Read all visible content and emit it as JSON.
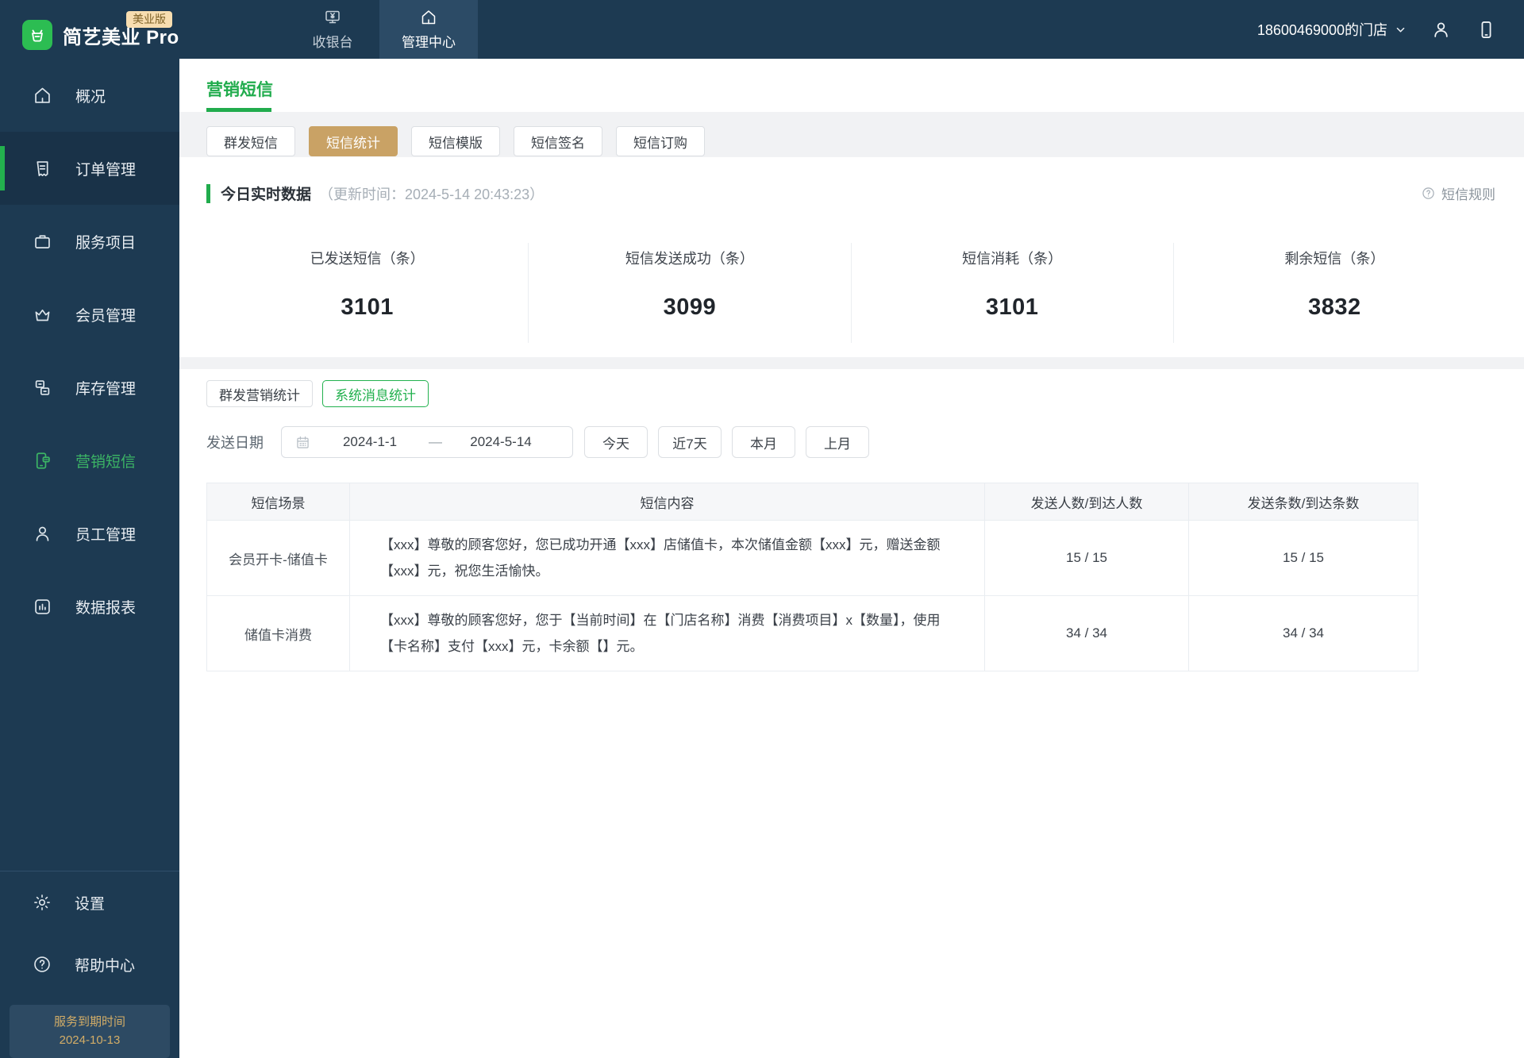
{
  "topbar": {
    "badge": "美业版",
    "brand": "简艺美业 Pro",
    "tabs": [
      {
        "label": "收银台",
        "icon": "cash-register-icon"
      },
      {
        "label": "管理中心",
        "icon": "home-icon"
      }
    ],
    "store": "18600469000的门店"
  },
  "sidebar": {
    "items": [
      {
        "label": "概况"
      },
      {
        "label": "订单管理"
      },
      {
        "label": "服务项目"
      },
      {
        "label": "会员管理"
      },
      {
        "label": "库存管理"
      },
      {
        "label": "营销短信"
      },
      {
        "label": "员工管理"
      },
      {
        "label": "数据报表"
      }
    ],
    "footer_items": [
      {
        "label": "设置"
      },
      {
        "label": "帮助中心"
      }
    ],
    "service_expire": {
      "line1": "服务到期时间",
      "line2": "2024-10-13"
    }
  },
  "page": {
    "title": "营销短信",
    "tabs": [
      "群发短信",
      "短信统计",
      "短信模版",
      "短信签名",
      "短信订购"
    ],
    "realtime": {
      "title": "今日实时数据",
      "update_time": "（更新时间：2024-5-14 20:43:23）",
      "rules_label": "短信规则",
      "stats": [
        {
          "label": "已发送短信（条）",
          "value": "3101"
        },
        {
          "label": "短信发送成功（条）",
          "value": "3099"
        },
        {
          "label": "短信消耗（条）",
          "value": "3101"
        },
        {
          "label": "剩余短信（条）",
          "value": "3832"
        }
      ]
    },
    "filter": {
      "stat_tabs": [
        "群发营销统计",
        "系统消息统计"
      ],
      "date_label": "发送日期",
      "date_start": "2024-1-1",
      "date_separator": "—",
      "date_end": "2024-5-14",
      "quick_buttons": [
        "今天",
        "近7天",
        "本月",
        "上月"
      ]
    },
    "table": {
      "headers": [
        "短信场景",
        "短信内容",
        "发送人数/到达人数",
        "发送条数/到达条数"
      ],
      "rows": [
        {
          "scene": "会员开卡-储值卡",
          "content": "【xxx】尊敬的顾客您好，您已成功开通【xxx】店储值卡，本次储值金额【xxx】元，赠送金额【xxx】元，祝您生活愉快。",
          "people": "15 / 15",
          "count": "15 / 15"
        },
        {
          "scene": "储值卡消费",
          "content": "【xxx】尊敬的顾客您好，您于【当前时间】在【门店名称】消费【消费项目】x【数量】，使用【卡名称】支付【xxx】元，卡余额【】元。",
          "people": "34 / 34",
          "count": "34 / 34"
        }
      ]
    },
    "colors": {
      "accent_green": "#21ac4d",
      "accent_tan": "#c9a265",
      "navy": "#1d3a52"
    }
  }
}
